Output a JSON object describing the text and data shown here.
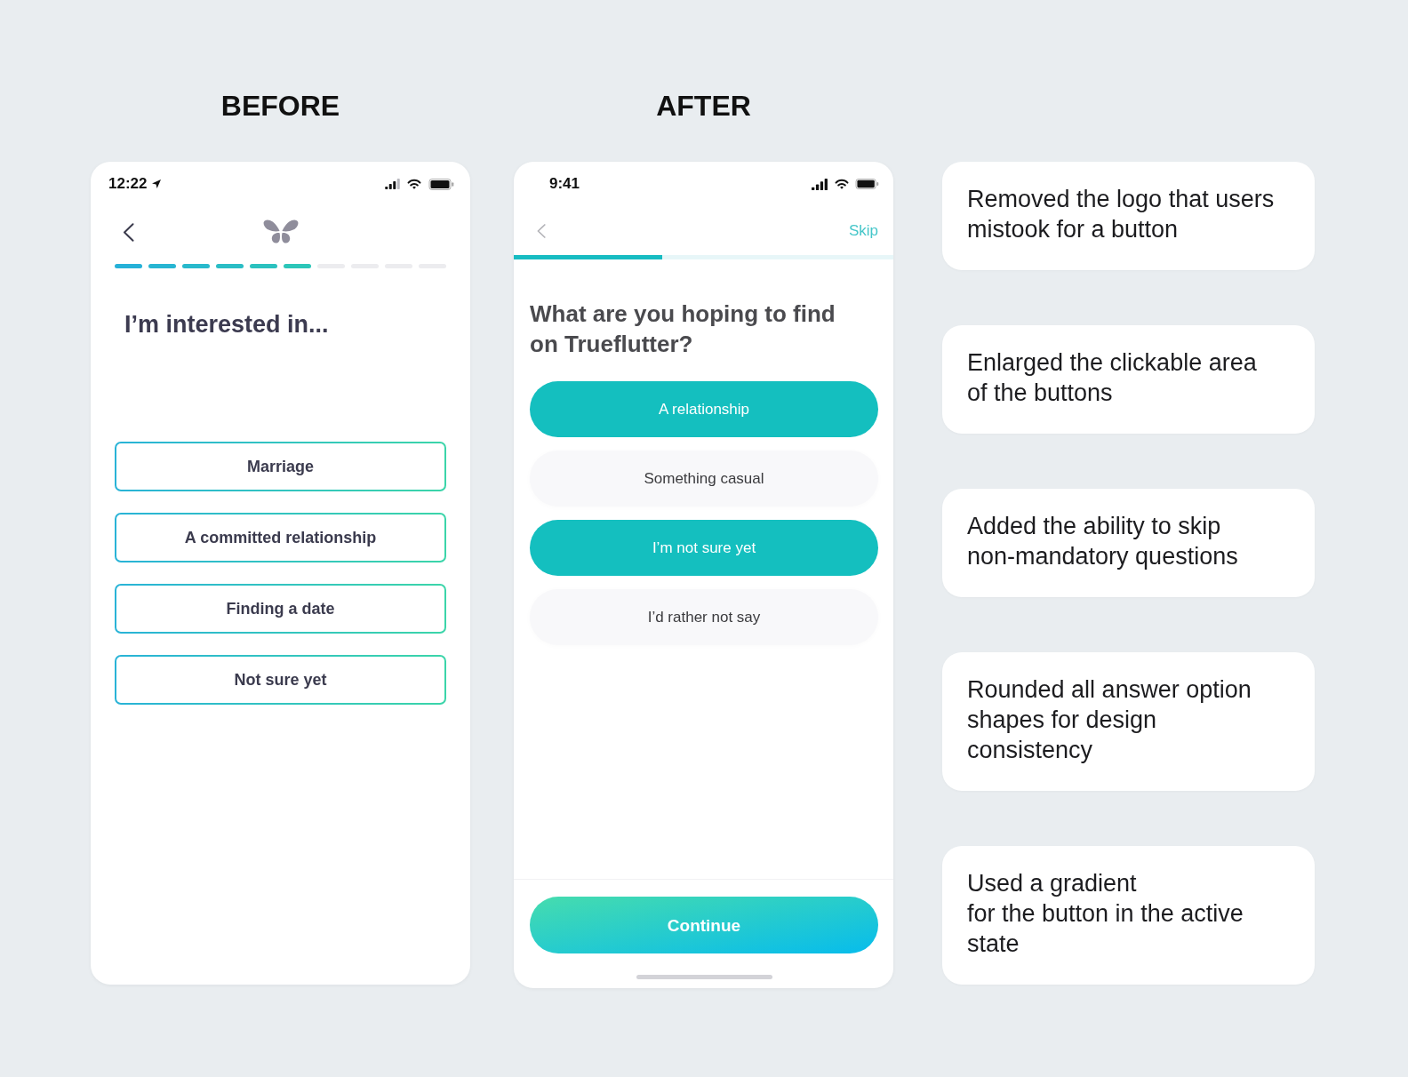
{
  "before": {
    "heading": "BEFORE",
    "phone": {
      "status_bar": {
        "time": "12:22"
      },
      "progress": {
        "segments": [
          {
            "filled": true
          },
          {
            "filled": true
          },
          {
            "filled": true
          },
          {
            "filled": true
          },
          {
            "filled": true
          },
          {
            "filled": true
          },
          {
            "filled": false
          },
          {
            "filled": false
          },
          {
            "filled": false
          },
          {
            "filled": false
          }
        ]
      },
      "title": "I’m interested in...",
      "options": [
        {
          "label": "Marriage",
          "selected": false
        },
        {
          "label": "A committed relationship",
          "selected": false
        },
        {
          "label": "Finding a date",
          "selected": false
        },
        {
          "label": "Not sure yet",
          "selected": false
        }
      ]
    }
  },
  "after": {
    "heading": "AFTER",
    "phone": {
      "status_bar": {
        "time": "9:41"
      },
      "skip": "Skip",
      "progress": {
        "level": 0.39
      },
      "question": "What are you hoping to find\non Trueflutter?",
      "options": [
        {
          "label": "A relationship",
          "selected": true
        },
        {
          "label": "Something casual",
          "selected": false
        },
        {
          "label": "I’m not sure yet",
          "selected": true
        },
        {
          "label": "I’d rather not say",
          "selected": false
        }
      ],
      "continue_button": {
        "label": "Continue",
        "active": true
      }
    }
  },
  "notes": [
    "Removed the logo that users\nmistook for a button",
    "Enlarged the clickable area\nof the buttons",
    "Added the ability to skip\nnon-mandatory questions",
    "Rounded all answer option\nshapes for design\nconsistency",
    "Used a gradient\nfor the button in the active\nstate"
  ]
}
